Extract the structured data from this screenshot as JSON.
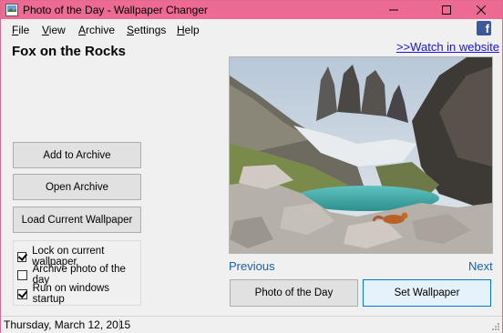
{
  "window": {
    "title": "Photo of the Day - Wallpaper Changer"
  },
  "menu": {
    "file": {
      "first": "F",
      "rest": "ile"
    },
    "view": {
      "first": "V",
      "rest": "iew"
    },
    "archive": {
      "first": "A",
      "rest": "rchive"
    },
    "settings": {
      "first": "S",
      "rest": "ettings"
    },
    "help": {
      "first": "H",
      "rest": "elp"
    }
  },
  "photo": {
    "title": "Fox on the Rocks",
    "watch_link": ">>Watch in website",
    "image_icon": "mountain-lake-photo"
  },
  "buttons": {
    "add_archive": "Add to Archive",
    "open_archive": "Open Archive",
    "load_current": "Load Current Wallpaper",
    "photo_of_day": "Photo of the Day",
    "set_wallpaper": "Set Wallpaper"
  },
  "options": [
    {
      "label": "Lock on current wallpaper",
      "checked": true
    },
    {
      "label": "Archive photo of the day",
      "checked": false
    },
    {
      "label": "Run on windows startup",
      "checked": true
    }
  ],
  "nav": {
    "previous": "Previous",
    "next": "Next"
  },
  "status": {
    "date": "Thursday, March 12, 2015"
  },
  "colors": {
    "titlebar": "#ec6a94",
    "link": "#1a14d8",
    "nav_link": "#1a5fb4",
    "facebook": "#3b5998"
  }
}
